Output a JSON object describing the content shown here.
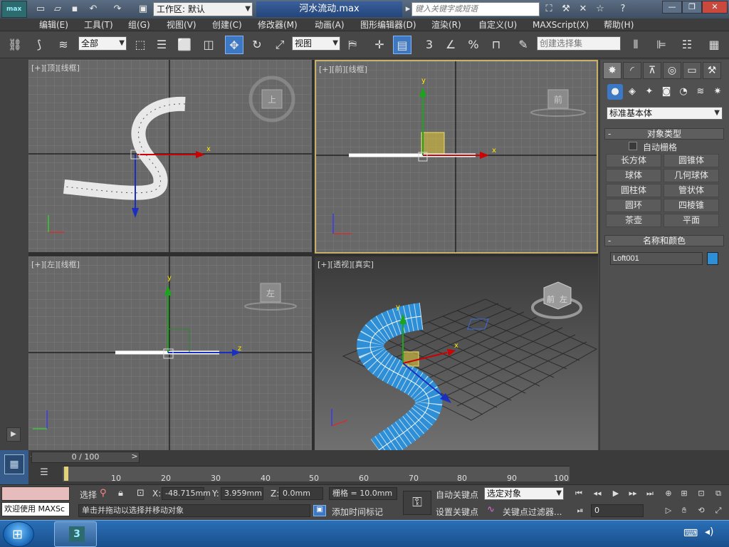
{
  "title_bar": {
    "app_logo": "max",
    "workspace": "工作区: 默认",
    "document_title": "河水流动.max",
    "search_placeholder": "键入关键字或短语",
    "icons": [
      "new-file-icon",
      "open-file-icon",
      "save-icon",
      "undo-icon",
      "redo-icon",
      "project-icon"
    ],
    "help_icons": [
      "binoculars-icon",
      "key-tools-icon",
      "exchange-icon",
      "star-icon",
      "help-icon"
    ],
    "window_buttons": {
      "minimize": "—",
      "restore": "❐",
      "close": "✕"
    }
  },
  "menu": {
    "items": [
      "编辑(E)",
      "工具(T)",
      "组(G)",
      "视图(V)",
      "创建(C)",
      "修改器(M)",
      "动画(A)",
      "图形编辑器(D)",
      "渲染(R)",
      "自定义(U)",
      "MAXScript(X)",
      "帮助(H)"
    ]
  },
  "toolbar": {
    "selection_filter": "全部",
    "reference_coord": "视图",
    "named_selection_placeholder": "创建选择集",
    "snap_toggle": "3",
    "percent_snap": "%"
  },
  "viewports": {
    "top": "[+][顶][线框]",
    "front": "[+][前][线框]",
    "left": "[+][左][线框]",
    "perspective": "[+][透视][真实]",
    "viewcube": {
      "top": "上",
      "front": "前",
      "left": "左",
      "persp_front": "前",
      "persp_left": "左"
    },
    "axes": {
      "x": "x",
      "y": "y",
      "z": "z"
    }
  },
  "command_panel": {
    "category": "标准基本体",
    "object_type_title": "对象类型",
    "auto_grid": "自动栅格",
    "object_buttons": [
      "长方体",
      "圆锥体",
      "球体",
      "几何球体",
      "圆柱体",
      "管状体",
      "圆环",
      "四棱锥",
      "茶壶",
      "平面"
    ],
    "name_color_title": "名称和颜色",
    "object_name": "Loft001",
    "object_color": "#2e8fd6",
    "rollout_minus": "-"
  },
  "timeline": {
    "slider_label": "0 / 100",
    "prev_arrow": "<",
    "next_arrow": ">",
    "ticks": [
      "10",
      "20",
      "30",
      "40",
      "50",
      "60",
      "70",
      "80",
      "90",
      "100"
    ]
  },
  "status": {
    "welcome": "欢迎使用 MAXSc",
    "select_label": "选择",
    "prompt": "单击并拖动以选择并移动对象",
    "x_label": "X:",
    "x_value": "-48.715mm",
    "y_label": "Y:",
    "y_value": "3.959mm",
    "z_label": "Z:",
    "z_value": "0.0mm",
    "grid": "栅格 = 10.0mm",
    "add_time_tag": "添加时间标记",
    "auto_key": "自动关键点",
    "set_key": "设置关键点",
    "selected_object": "选定对象",
    "key_filters": "关键点过滤器...",
    "frame": "0"
  }
}
